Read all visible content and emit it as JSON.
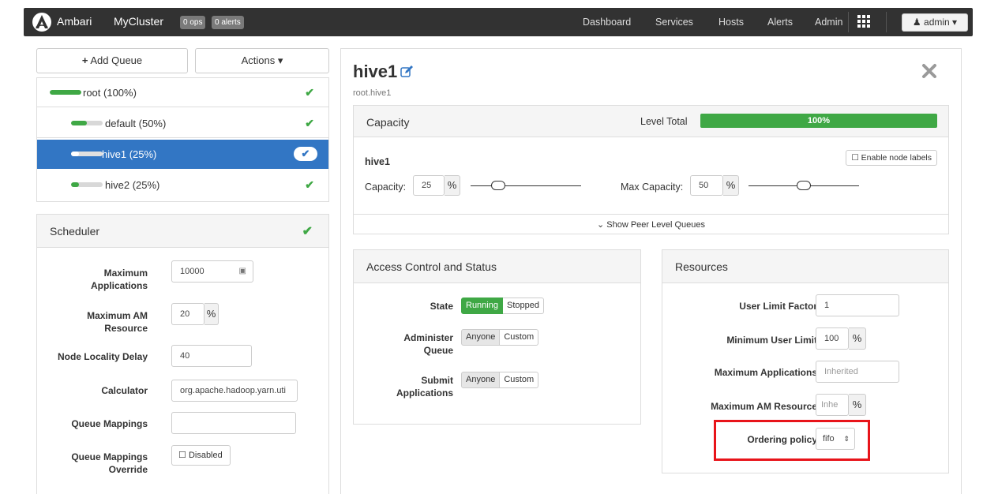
{
  "navbar": {
    "brand": "Ambari",
    "cluster": "MyCluster",
    "ops_badge": "0 ops",
    "alerts_badge": "0 alerts",
    "links": [
      "Dashboard",
      "Services",
      "Hosts",
      "Alerts",
      "Admin"
    ],
    "user": "admin"
  },
  "toolbar": {
    "add_queue": "Add Queue",
    "actions": "Actions"
  },
  "queues": [
    {
      "label": "root (100%)",
      "fill": 100,
      "active": false
    },
    {
      "label": "default (50%)",
      "fill": 50,
      "active": false
    },
    {
      "label": "hive1 (25%)",
      "fill": 25,
      "active": true
    },
    {
      "label": "hive2 (25%)",
      "fill": 25,
      "active": false
    }
  ],
  "scheduler": {
    "title": "Scheduler",
    "max_apps_label": "Maximum Applications",
    "max_apps_value": "10000",
    "max_am_label": "Maximum AM Resource",
    "max_am_value": "20",
    "max_am_unit": "%",
    "locality_label": "Node Locality Delay",
    "locality_value": "40",
    "calculator_label": "Calculator",
    "calculator_value": "org.apache.hadoop.yarn.uti",
    "mappings_label": "Queue Mappings",
    "mappings_value": "",
    "override_label": "Queue Mappings Override",
    "override_btn": "Disabled"
  },
  "detail": {
    "title": "hive1",
    "path": "root.hive1"
  },
  "capacity": {
    "title": "Capacity",
    "level_total_label": "Level Total",
    "level_total_value": "100%",
    "enable_labels": "Enable node labels",
    "queue_name": "hive1",
    "capacity_label": "Capacity:",
    "capacity_value": "25",
    "capacity_unit": "%",
    "capacity_slider": 0.25,
    "max_label": "Max Capacity:",
    "max_value": "50",
    "max_unit": "%",
    "max_slider": 0.5,
    "peer_link": "Show Peer Level Queues"
  },
  "access": {
    "title": "Access Control and Status",
    "state_label": "State",
    "state_on": "Running",
    "state_off": "Stopped",
    "admin_label": "Administer Queue",
    "admin_opt1": "Anyone",
    "admin_opt2": "Custom",
    "submit_label": "Submit Applications",
    "submit_opt1": "Anyone",
    "submit_opt2": "Custom"
  },
  "resources": {
    "title": "Resources",
    "ulf_label": "User Limit Factor",
    "ulf_value": "1",
    "mul_label": "Minimum User Limit",
    "mul_value": "100",
    "mul_unit": "%",
    "maxapps_label": "Maximum Applications",
    "maxapps_placeholder": "Inherited",
    "maxam_label": "Maximum AM Resource",
    "maxam_placeholder": "Inhe",
    "maxam_unit": "%",
    "ordering_label": "Ordering policy",
    "ordering_value": "fifo"
  },
  "colors": {
    "accent_blue": "#3276c4",
    "success_green": "#3fa845",
    "highlight_red": "#e8141a",
    "navbar_bg": "#323232"
  }
}
